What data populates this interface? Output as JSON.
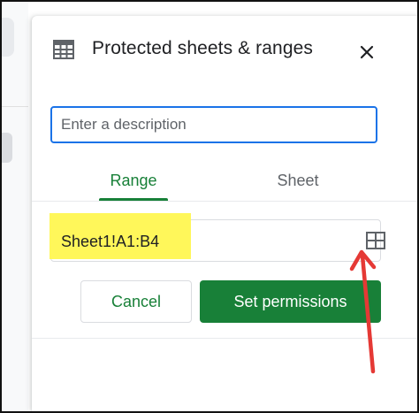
{
  "panel": {
    "title": "Protected sheets & ranges",
    "description_placeholder": "Enter a description",
    "description_value": ""
  },
  "tabs": [
    {
      "label": "Range",
      "active": true
    },
    {
      "label": "Sheet",
      "active": false
    }
  ],
  "range": {
    "value": "Sheet1!A1:B4"
  },
  "buttons": {
    "cancel": "Cancel",
    "set_permissions": "Set permissions"
  },
  "icons": {
    "header": "table-icon",
    "close": "close-icon",
    "range_select": "grid-select-icon"
  },
  "colors": {
    "accent_green": "#188038",
    "focus_blue": "#1a73e8",
    "highlight_yellow": "#fff75a",
    "annotation_red": "#e53935"
  }
}
